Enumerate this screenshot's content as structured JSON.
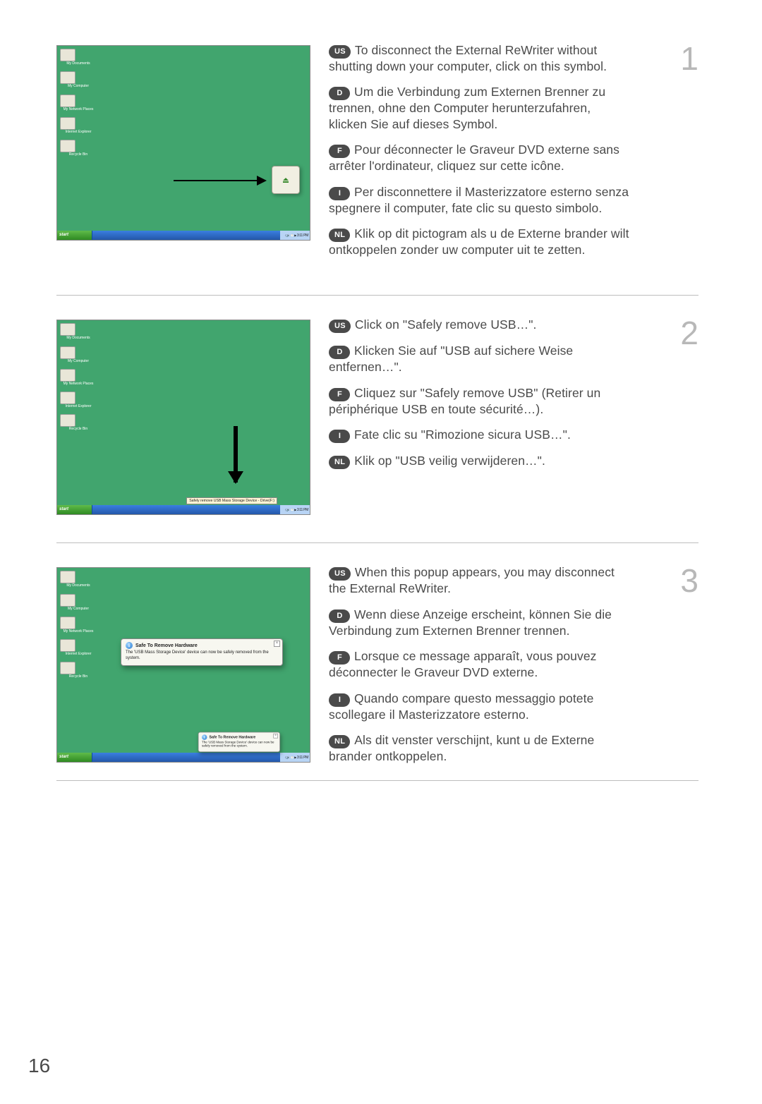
{
  "page_number": "16",
  "screenshot_common": {
    "icons": [
      {
        "label": "My Documents"
      },
      {
        "label": "My Computer"
      },
      {
        "label": "My Network Places"
      },
      {
        "label": "Internet Explorer"
      },
      {
        "label": "Recycle Bin"
      }
    ],
    "start": "start",
    "clock": "3:11 PM",
    "step2_tooltip": "Safely remove USB Mass Storage Device - Drive(F:)",
    "step3_popup_title": "Safe To Remove Hardware",
    "step3_popup_body": "The 'USB Mass Storage Device' device can now be safely removed from the system.",
    "step3_zoom_title": "Safe To Remove Hardware",
    "step3_zoom_body": "The 'USB Mass Storage Device' device can now be safely removed from the system."
  },
  "steps": [
    {
      "number": "1",
      "langs": [
        {
          "code": "US",
          "text": "To disconnect the External ReWriter without shutting down your computer, click on this symbol."
        },
        {
          "code": "D",
          "text": "Um die Verbindung zum Externen Brenner zu trennen, ohne den Computer herunterzufahren, klicken Sie auf dieses Symbol."
        },
        {
          "code": "F",
          "text": "Pour déconnecter le Graveur DVD externe sans arrêter l'ordinateur, cliquez sur cette icône."
        },
        {
          "code": "I",
          "text": "Per disconnettere il Masterizzatore esterno senza spegnere il computer, fate clic su questo simbolo."
        },
        {
          "code": "NL",
          "text": "Klik op dit pictogram als u de Externe brander wilt ontkoppelen zonder uw computer uit te zetten."
        }
      ]
    },
    {
      "number": "2",
      "langs": [
        {
          "code": "US",
          "text": "Click on \"Safely remove USB…\"."
        },
        {
          "code": "D",
          "text": "Klicken Sie auf \"USB auf sichere Weise entfernen…\"."
        },
        {
          "code": "F",
          "text": "Cliquez sur \"Safely remove USB\" (Retirer un périphérique USB en toute sécurité…)."
        },
        {
          "code": "I",
          "text": "Fate clic su \"Rimozione sicura USB…\"."
        },
        {
          "code": "NL",
          "text": "Klik op \"USB veilig verwijderen…\"."
        }
      ]
    },
    {
      "number": "3",
      "langs": [
        {
          "code": "US",
          "text": "When this popup appears, you may disconnect the External ReWriter."
        },
        {
          "code": "D",
          "text": "Wenn diese Anzeige erscheint, können Sie die Verbindung zum Externen Brenner trennen."
        },
        {
          "code": "F",
          "text": "Lorsque ce message apparaît, vous pouvez déconnecter le Graveur DVD externe."
        },
        {
          "code": "I",
          "text": "Quando compare questo messaggio potete scollegare il Masterizzatore esterno."
        },
        {
          "code": "NL",
          "text": "Als dit venster verschijnt, kunt u de Externe brander ontkoppelen."
        }
      ]
    }
  ]
}
